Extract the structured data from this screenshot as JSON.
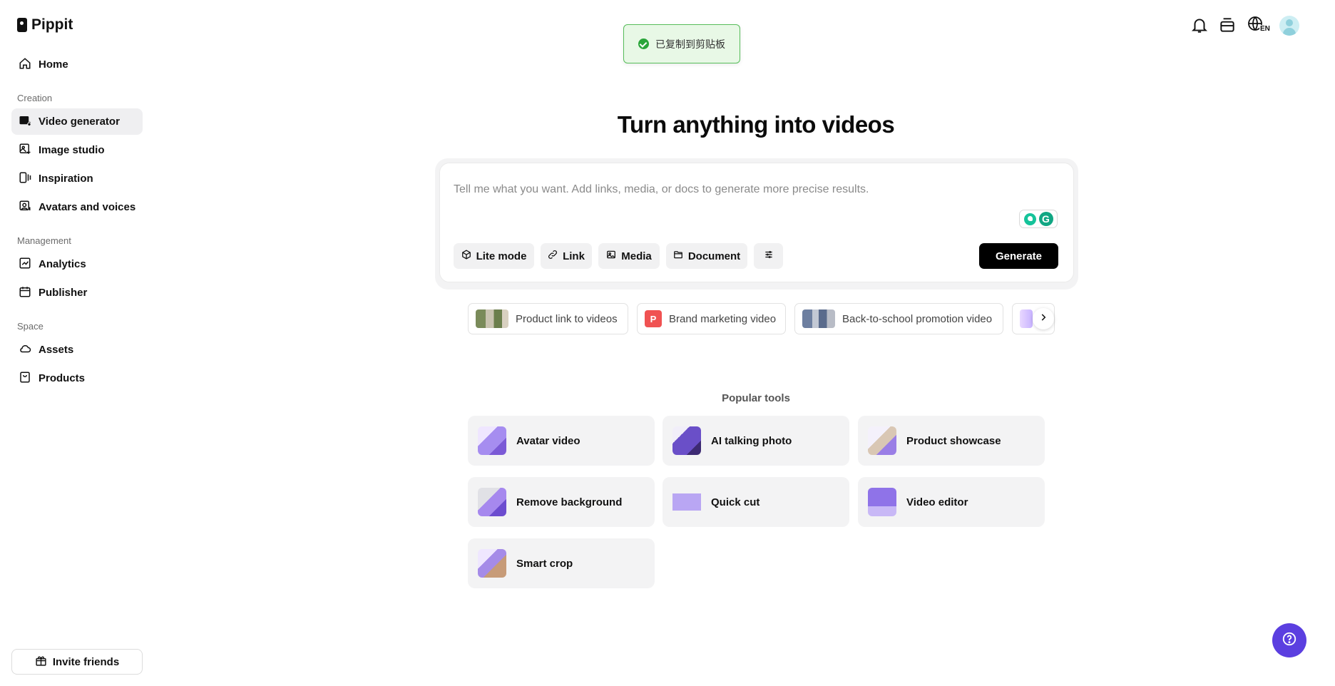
{
  "app": {
    "name": "Pippit"
  },
  "sidebar": {
    "items": [
      {
        "label": "Home",
        "icon": "home-icon"
      },
      {
        "label": "Video generator",
        "icon": "video-generator-icon",
        "active": true
      },
      {
        "label": "Image studio",
        "icon": "image-studio-icon"
      },
      {
        "label": "Inspiration",
        "icon": "inspiration-icon"
      },
      {
        "label": "Avatars and voices",
        "icon": "avatar-voice-icon"
      },
      {
        "label": "Analytics",
        "icon": "analytics-icon"
      },
      {
        "label": "Publisher",
        "icon": "calendar-icon"
      },
      {
        "label": "Assets",
        "icon": "cloud-icon"
      },
      {
        "label": "Products",
        "icon": "bag-icon"
      }
    ],
    "sections": {
      "creation": "Creation",
      "management": "Management",
      "space": "Space"
    },
    "invite_label": "Invite friends"
  },
  "topbar": {
    "icons": [
      "bell-icon",
      "stack-icon",
      "globe-icon",
      "avatar"
    ],
    "language_badge": "EN"
  },
  "toast": {
    "text": "已复制到剪贴板",
    "color": "#2aa53a"
  },
  "main": {
    "title": "Turn anything into videos",
    "prompt": {
      "placeholder": "Tell me what you want. Add links, media, or docs to generate more precise results.",
      "value": ""
    },
    "chips": {
      "lite_mode": "Lite mode",
      "link": "Link",
      "media": "Media",
      "document": "Document"
    },
    "generate_label": "Generate",
    "suggestions": [
      {
        "label": "Product link to videos"
      },
      {
        "label": "Brand marketing video",
        "badge": "P"
      },
      {
        "label": "Back-to-school promotion video"
      }
    ],
    "popular_title": "Popular tools",
    "tools": [
      {
        "label": "Avatar video"
      },
      {
        "label": "AI talking photo"
      },
      {
        "label": "Product showcase"
      },
      {
        "label": "Remove background"
      },
      {
        "label": "Quick cut"
      },
      {
        "label": "Video editor"
      },
      {
        "label": "Smart crop"
      }
    ]
  },
  "colors": {
    "accent": "#5b3fe0",
    "primary_button": "#000000",
    "toast_bg": "#e8f8e6",
    "toast_border": "#57bd5a"
  }
}
